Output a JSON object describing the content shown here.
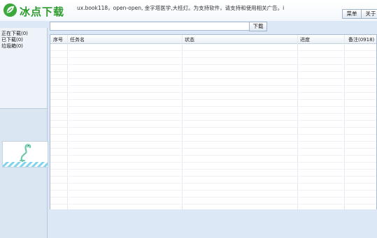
{
  "app": {
    "title": "冰点下载",
    "marquee": "ux.book118，open-open, 金字塔医学,大桂灯。为支持软件，请支持和使用相关广告。i"
  },
  "header": {
    "menu_label": "菜单",
    "about_label": "关于"
  },
  "sidebar": {
    "items": [
      {
        "label": "正在下载(0)"
      },
      {
        "label": "已下载(0)"
      },
      {
        "label": "垃圾箱(0)"
      }
    ]
  },
  "search": {
    "value": "",
    "placeholder": "",
    "button_label": "下载"
  },
  "table": {
    "columns": [
      "序号",
      "任务名",
      "状态",
      "进度",
      "备注(0918)"
    ],
    "rows": []
  },
  "colors": {
    "brand": "#2e9a2e",
    "background": "#dce8f5",
    "border": "#a9bad0"
  }
}
